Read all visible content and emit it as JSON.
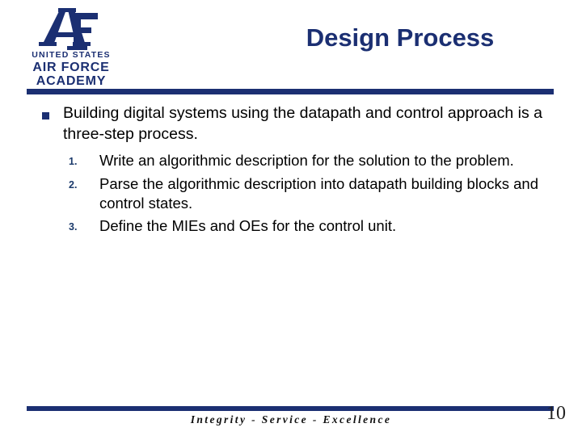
{
  "slide": {
    "title": "Design Process",
    "page_number": "10",
    "accent_color": "#1B2F72",
    "body_text_color": "#000000",
    "background_color": "#FFFFFF"
  },
  "logo": {
    "monogram": "AF",
    "line1": "UNITED STATES",
    "line2": "AIR FORCE",
    "line3": "ACADEMY"
  },
  "body": {
    "bullet": {
      "marker": "square-bullet",
      "text": "Building digital systems using the datapath and control approach is a three-step process."
    },
    "steps": [
      {
        "marker": "1.",
        "text": "Write an algorithmic description for the solution to the problem."
      },
      {
        "marker": "2.",
        "text": "Parse the algorithmic description into datapath building blocks and control states."
      },
      {
        "marker": "3.",
        "text": "Define the MIEs and OEs for the control unit."
      }
    ]
  },
  "footer": {
    "motto": "Integrity - Service - Excellence"
  }
}
